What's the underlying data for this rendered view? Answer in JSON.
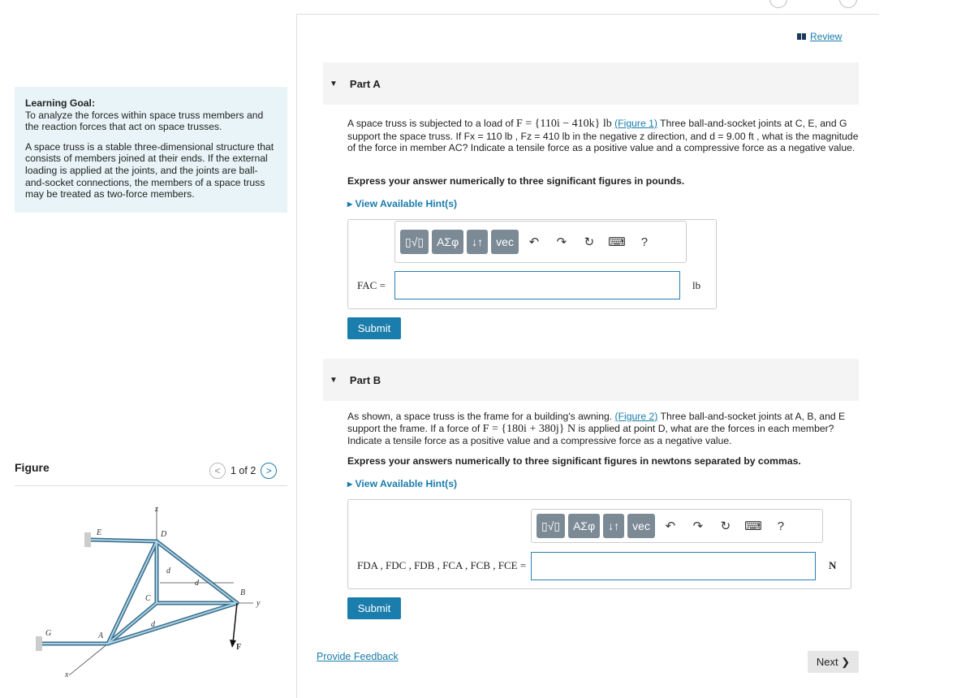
{
  "header": {
    "review_label": "Review"
  },
  "learning_goal": {
    "title": "Learning Goal:",
    "goal": "To analyze the forces within space truss members and the reaction forces that act on space trusses.",
    "description": "A space truss is a stable three-dimensional structure that consists of members joined at their ends. If the external loading is applied at the joints, and the joints are ball-and-socket connections, the members of a space truss may be treated as two-force members."
  },
  "figure": {
    "label": "Figure",
    "pager": "1 of 2",
    "labels": {
      "z": "z",
      "E": "E",
      "D": "D",
      "d1": "d",
      "d2": "d",
      "d3": "d",
      "C": "C",
      "B": "B",
      "y": "y",
      "G": "G",
      "A": "A",
      "F": "F",
      "x": "x"
    }
  },
  "part_a": {
    "title": "Part A",
    "text1": "A space truss is subjected to a load of ",
    "math1": "F = {110i − 410k} lb",
    "fig_link": "(Figure 1)",
    "text2": " Three ball-and-socket joints at C, E, and G support the space truss. If Fx = 110 lb , Fz = 410 lb in the negative z direction, and d = 9.00 ft , what is the magnitude of the force in member AC? Indicate a tensile force as a positive value and a compressive force as a negative value.",
    "express": "Express your answer numerically to three significant figures in pounds.",
    "hint": "View Available Hint(s)",
    "answer_label": "FAC =",
    "answer_value": "",
    "unit": "lb",
    "submit": "Submit"
  },
  "part_b": {
    "title": "Part B",
    "text1": "As shown, a space truss is the frame for a building's awning. ",
    "fig_link": "(Figure 2)",
    "text2": " Three ball-and-socket joints at A, B, and E support the frame. If a force of ",
    "math1": "F = {180i + 380j} N",
    "text3": " is applied at point D, what are the forces in each member? Indicate a tensile force as a positive value and a compressive force as a negative value.",
    "express": "Express your answers numerically to three significant figures in newtons separated by commas.",
    "hint": "View Available Hint(s)",
    "answer_label": "FDA , FDC , FDB , FCA , FCB , FCE =",
    "answer_value": "",
    "unit": "N",
    "submit": "Submit"
  },
  "toolbar": {
    "templates": "▯√▯",
    "symbols": "ΑΣφ",
    "arrows": "↓↑",
    "vec": "vec",
    "undo": "↶",
    "redo": "↷",
    "reset": "↻",
    "keyboard": "⌨",
    "help": "?"
  },
  "footer": {
    "feedback": "Provide Feedback",
    "next": "Next ❯"
  }
}
